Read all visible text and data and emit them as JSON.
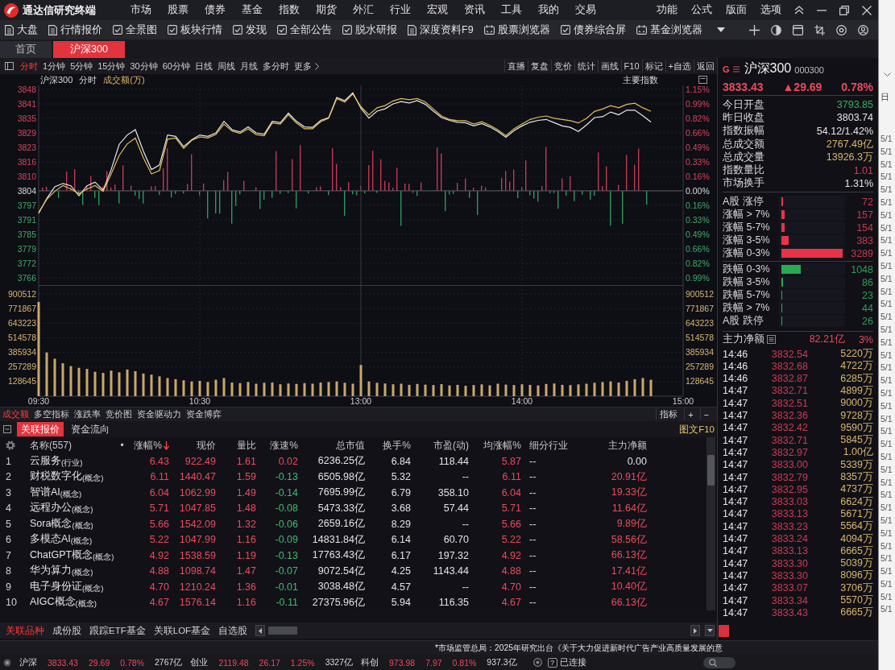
{
  "title_bar": {
    "app_name": "通达信研究终端",
    "menus": [
      "市场",
      "股票",
      "债券",
      "基金",
      "指数",
      "期货",
      "外汇",
      "行业",
      "宏观",
      "资讯",
      "工具",
      "我的",
      "交易"
    ],
    "right_menus": [
      "功能",
      "公式",
      "版面",
      "选项"
    ]
  },
  "toolbar": [
    {
      "label": "大盘",
      "kind": "doc"
    },
    {
      "label": "行情报价",
      "kind": "doc"
    },
    {
      "label": "全景图",
      "kind": "check"
    },
    {
      "label": "板块行情",
      "kind": "check"
    },
    {
      "label": "发现",
      "kind": "check"
    },
    {
      "label": "全部公告",
      "kind": "check"
    },
    {
      "label": "脱水研报",
      "kind": "check"
    },
    {
      "label": "深度资料F9",
      "kind": "doc"
    },
    {
      "label": "股票浏览器",
      "kind": "calendar"
    },
    {
      "label": "债券综合屏",
      "kind": "check"
    },
    {
      "label": "基金浏览器",
      "kind": "calendar"
    }
  ],
  "page_tabs": [
    {
      "label": "首页",
      "selected": false
    },
    {
      "label": "沪深300",
      "selected": true
    }
  ],
  "periods": [
    {
      "label": "分时",
      "kind": "period",
      "selected": true
    },
    {
      "label": "1分钟",
      "kind": "period",
      "selected": false
    },
    {
      "label": "5分钟",
      "kind": "period",
      "selected": false
    },
    {
      "label": "15分钟",
      "kind": "period",
      "selected": false
    },
    {
      "label": "30分钟",
      "kind": "period",
      "selected": false
    },
    {
      "label": "60分钟",
      "kind": "period",
      "selected": false
    },
    {
      "label": "日线",
      "kind": "period",
      "selected": false
    },
    {
      "label": "周线",
      "kind": "period",
      "selected": false
    },
    {
      "label": "月线",
      "kind": "period",
      "selected": false
    },
    {
      "label": "多分时",
      "kind": "period",
      "selected": false
    },
    {
      "label": "更多",
      "kind": "more",
      "selected": false
    }
  ],
  "chart_tools": [
    "直播",
    "复盘",
    "竞价",
    "统计",
    "画线",
    "F10",
    "标记",
    "+自选",
    "返回"
  ],
  "chart_header": {
    "name": "沪深300",
    "period": "分时",
    "indicator": "成交额(万)",
    "index_menu": "主要指数"
  },
  "chart_data": [
    {
      "type": "line",
      "tick_labels": "y",
      "series": [
        {
          "color": "#e8e8e8",
          "values": [
            3794.0,
            3800.4,
            3805.5,
            3806.9,
            3805.9,
            3801.6,
            3805.9,
            3807.5,
            3804.0,
            3812.9,
            3823.8,
            3827.8,
            3830.1,
            3820.8,
            3812.9,
            3814.9,
            3827.8,
            3827.2,
            3822.8,
            3825.8,
            3827.8,
            3827.2,
            3828.7,
            3833.7,
            3830.1,
            3829.1,
            3831.3,
            3828.7,
            3828.2,
            3833.7,
            3833.1,
            3837.3,
            3833.7,
            3831.3,
            3831.1,
            3834.1,
            3835.3,
            3844.0,
            3842.6,
            3846.0,
            3839.3,
            3835.1,
            3838.1,
            3839.1,
            3841.2,
            3842.2,
            3841.6,
            3842.6,
            3841.0,
            3838.1,
            3835.3,
            3834.1,
            3833.3,
            3833.1,
            3831.7,
            3832.7,
            3831.3,
            3829.3,
            3826.8,
            3829.7,
            3831.7,
            3833.3,
            3834.1,
            3834.5,
            3833.1,
            3831.7,
            3831.1,
            3829.3,
            3832.1,
            3835.3,
            3835.7,
            3837.7,
            3836.5,
            3838.5,
            3838.5,
            3836.1,
            3833.4,
            null,
            null,
            null,
            null
          ]
        },
        {
          "color": "#e3bd55",
          "values": [
            3794.5,
            3800.0,
            3803.5,
            3806.0,
            3804.5,
            3802.5,
            3804.5,
            3806.0,
            3803.5,
            3811.0,
            3819.0,
            3824.0,
            3826.5,
            3818.0,
            3811.0,
            3812.5,
            3826.0,
            3826.5,
            3822.0,
            3825.5,
            3827.0,
            3826.5,
            3828.0,
            3832.5,
            3829.5,
            3828.5,
            3830.5,
            3828.0,
            3827.5,
            3833.0,
            3832.5,
            3836.5,
            3833.0,
            3830.5,
            3830.5,
            3833.5,
            3835.0,
            3843.5,
            3842.0,
            3845.5,
            3840.0,
            3836.5,
            3839.5,
            3840.5,
            3842.5,
            3843.5,
            3843.0,
            3843.5,
            3842.0,
            3839.0,
            3836.0,
            3834.5,
            3834.0,
            3834.0,
            3832.5,
            3833.5,
            3832.0,
            3830.0,
            3827.5,
            3830.5,
            3832.5,
            3834.5,
            3835.5,
            3836.0,
            3835.0,
            3834.5,
            3834.0,
            3833.0,
            3835.0,
            3838.0,
            3839.0,
            3840.5,
            3839.5,
            3841.0,
            3841.5,
            3839.5,
            3838.0,
            null,
            null,
            null,
            null
          ]
        }
      ],
      "ylim": [
        3763.1,
        3849.2
      ],
      "yticks": [
        {
          "value": 3847.5,
          "label": "3848"
        },
        {
          "value": 3841.2,
          "label": "3841"
        },
        {
          "value": 3835.0,
          "label": "3835"
        },
        {
          "value": 3828.7,
          "label": "3829"
        },
        {
          "value": 3822.5,
          "label": "3823"
        },
        {
          "value": 3816.2,
          "label": "3816"
        },
        {
          "value": 3810.0,
          "label": "3810"
        },
        {
          "value": 3803.7,
          "label": "3804"
        },
        {
          "value": 3797.5,
          "label": "3797"
        },
        {
          "value": 3791.2,
          "label": "3791"
        },
        {
          "value": 3785.0,
          "label": "3785"
        },
        {
          "value": 3778.7,
          "label": "3779"
        },
        {
          "value": 3772.5,
          "label": "3772"
        },
        {
          "value": 3766.2,
          "label": "3766"
        }
      ],
      "y2lim": [
        -1.068,
        1.195
      ],
      "y2ticks": [
        {
          "value": 1.15,
          "label": "1.15%"
        },
        {
          "value": 0.986,
          "label": "0.99%"
        },
        {
          "value": 0.821,
          "label": "0.82%"
        },
        {
          "value": 0.657,
          "label": "0.66%"
        },
        {
          "value": 0.493,
          "label": "0.49%"
        },
        {
          "value": 0.329,
          "label": "0.33%"
        },
        {
          "value": 0.164,
          "label": "0.16%"
        },
        {
          "value": 0,
          "label": "0.00%"
        },
        {
          "value": -0.164,
          "label": "0.16%"
        },
        {
          "value": -0.329,
          "label": "0.33%"
        },
        {
          "value": -0.493,
          "label": "0.49%"
        },
        {
          "value": -0.657,
          "label": "0.66%"
        },
        {
          "value": -0.821,
          "label": "0.82%"
        },
        {
          "value": -0.986,
          "label": "0.99%"
        }
      ],
      "ref_lines": [
        {
          "axis": "y",
          "value": 3803.74,
          "color": "#5c5c68",
          "line_style": "solid"
        }
      ],
      "grid": true
    },
    {
      "type": "bar",
      "categories": [
        "09:30",
        null,
        null,
        null,
        null,
        null,
        null,
        null,
        null,
        null,
        null,
        null,
        null,
        null,
        null,
        null,
        null,
        null,
        null,
        null,
        "10:30",
        null,
        null,
        null,
        null,
        null,
        null,
        null,
        null,
        null,
        null,
        null,
        null,
        null,
        null,
        null,
        null,
        null,
        null,
        null,
        "13:00",
        null,
        null,
        null,
        null,
        null,
        null,
        null,
        null,
        null,
        null,
        null,
        null,
        null,
        null,
        null,
        null,
        null,
        null,
        null,
        "14:00",
        null,
        null,
        null,
        null,
        null,
        null,
        null,
        null,
        null,
        null,
        null,
        null,
        null,
        null,
        null,
        null,
        null,
        null,
        null,
        "15:00"
      ],
      "values": [
        830000,
        385000,
        330000,
        290000,
        265000,
        250000,
        240000,
        215000,
        205000,
        225000,
        210000,
        235000,
        220000,
        200000,
        190000,
        175000,
        160000,
        150000,
        140000,
        130000,
        135000,
        125000,
        145000,
        160000,
        120000,
        115000,
        125000,
        110000,
        118000,
        120000,
        105000,
        112000,
        108000,
        115000,
        110000,
        120000,
        125000,
        130000,
        118000,
        110000,
        275000,
        130000,
        118000,
        112000,
        105000,
        110000,
        100000,
        108000,
        102000,
        98000,
        106000,
        95000,
        100000,
        92000,
        98000,
        104000,
        96000,
        110000,
        102000,
        98000,
        105000,
        100000,
        95000,
        108000,
        112000,
        100000,
        98000,
        104000,
        110000,
        118000,
        125000,
        130000,
        120000,
        135000,
        150000,
        160000,
        145000,
        null,
        null,
        null,
        null
      ],
      "color": "#c9a86c",
      "ylim": [
        0,
        978400
      ],
      "yticks": [
        128645,
        257289,
        385934,
        514578,
        643223,
        771867,
        900512
      ],
      "y2lim": [
        0,
        978400
      ],
      "y2ticks": [
        128645,
        257289,
        385934,
        514578,
        643223,
        771867,
        900512
      ],
      "grid": true
    }
  ],
  "indicator_tabs": [
    {
      "label": "成交额",
      "selected": true
    },
    {
      "label": "多空指标",
      "selected": false
    },
    {
      "label": "涨跌率",
      "selected": false
    },
    {
      "label": "竞价图",
      "selected": false
    },
    {
      "label": "资金驱动力",
      "selected": false
    },
    {
      "label": "资金博弈",
      "selected": false
    }
  ],
  "indicator_tools": [
    "指标",
    "+",
    "−"
  ],
  "table_tabs": [
    {
      "label": "关联报价",
      "selected": true
    },
    {
      "label": "资金流向",
      "selected": false
    }
  ],
  "table_link": "图文F10",
  "table": {
    "columns": [
      {
        "label": "名称(557)",
        "sorted": false
      },
      {
        "label": "•",
        "sorted": false
      },
      {
        "label": "涨幅%",
        "sorted": true
      },
      {
        "label": "现价",
        "sorted": false
      },
      {
        "label": "量比",
        "sorted": false
      },
      {
        "label": "涨速%",
        "sorted": false
      },
      {
        "label": "总市值",
        "sorted": false
      },
      {
        "label": "换手%",
        "sorted": false
      },
      {
        "label": "市盈(动)",
        "sorted": false
      },
      {
        "label": "均涨幅%",
        "sorted": false
      },
      {
        "label": "细分行业",
        "sorted": false
      },
      {
        "label": "主力净额",
        "sorted": false
      }
    ],
    "rows": [
      {
        "no": "1",
        "name": "云服务$_{(行业)}$",
        "change": "6.43",
        "price": "922.49",
        "vol_ratio": "1.61",
        "speed": "0.02",
        "cap": "6236.25亿",
        "turnover": "6.84",
        "pe": "118.44",
        "avg_change": "5.87",
        "industry": "--",
        "net_flow": "0.00",
        "up": true,
        "speed_up": true,
        "flow_up": false
      },
      {
        "no": "2",
        "name": "财税数字化$_{(概念)}$",
        "change": "6.11",
        "price": "1440.47",
        "vol_ratio": "1.59",
        "speed": "-0.13",
        "cap": "6505.98亿",
        "turnover": "5.32",
        "pe": "--",
        "avg_change": "6.11",
        "industry": "--",
        "net_flow": "20.91亿",
        "up": true,
        "speed_up": false,
        "flow_up": true
      },
      {
        "no": "3",
        "name": "智谱AI$_{(概念)}$",
        "change": "6.04",
        "price": "1062.99",
        "vol_ratio": "1.49",
        "speed": "-0.14",
        "cap": "7695.99亿",
        "turnover": "6.79",
        "pe": "358.10",
        "avg_change": "6.04",
        "industry": "--",
        "net_flow": "19.33亿",
        "up": true,
        "speed_up": false,
        "flow_up": true
      },
      {
        "no": "4",
        "name": "远程办公$_{(概念)}$",
        "change": "5.71",
        "price": "1047.85",
        "vol_ratio": "1.48",
        "speed": "-0.08",
        "cap": "5473.33亿",
        "turnover": "3.68",
        "pe": "57.44",
        "avg_change": "5.71",
        "industry": "--",
        "net_flow": "11.64亿",
        "up": true,
        "speed_up": false,
        "flow_up": true
      },
      {
        "no": "5",
        "name": "Sora概念$_{(概念)}$",
        "change": "5.66",
        "price": "1542.09",
        "vol_ratio": "1.32",
        "speed": "-0.06",
        "cap": "2659.16亿",
        "turnover": "8.29",
        "pe": "--",
        "avg_change": "5.66",
        "industry": "--",
        "net_flow": "9.89亿",
        "up": true,
        "speed_up": false,
        "flow_up": true
      },
      {
        "no": "6",
        "name": "多模态AI$_{(概念)}$",
        "change": "5.22",
        "price": "1047.99",
        "vol_ratio": "1.16",
        "speed": "-0.09",
        "cap": "14831.84亿",
        "turnover": "6.14",
        "pe": "60.70",
        "avg_change": "5.22",
        "industry": "--",
        "net_flow": "58.56亿",
        "up": true,
        "speed_up": false,
        "flow_up": true
      },
      {
        "no": "7",
        "name": "ChatGPT概念$_{(概念)}$",
        "change": "4.92",
        "price": "1538.59",
        "vol_ratio": "1.19",
        "speed": "-0.13",
        "cap": "17763.43亿",
        "turnover": "6.17",
        "pe": "197.32",
        "avg_change": "4.92",
        "industry": "--",
        "net_flow": "66.13亿",
        "up": true,
        "speed_up": false,
        "flow_up": true
      },
      {
        "no": "8",
        "name": "华为算力$_{(概念)}$",
        "change": "4.88",
        "price": "1098.74",
        "vol_ratio": "1.47",
        "speed": "-0.07",
        "cap": "9072.54亿",
        "turnover": "4.25",
        "pe": "1143.44",
        "avg_change": "4.88",
        "industry": "--",
        "net_flow": "17.41亿",
        "up": true,
        "speed_up": false,
        "flow_up": true
      },
      {
        "no": "9",
        "name": "电子身份证$_{(概念)}$",
        "change": "4.70",
        "price": "1210.24",
        "vol_ratio": "1.36",
        "speed": "-0.01",
        "cap": "3038.48亿",
        "turnover": "4.57",
        "pe": "--",
        "avg_change": "4.70",
        "industry": "--",
        "net_flow": "10.40亿",
        "up": true,
        "speed_up": false,
        "flow_up": true
      },
      {
        "no": "10",
        "name": "AIGC概念$_{(概念)}$",
        "change": "4.67",
        "price": "1576.14",
        "vol_ratio": "1.16",
        "speed": "-0.11",
        "cap": "27375.96亿",
        "turnover": "5.94",
        "pe": "116.35",
        "avg_change": "4.67",
        "industry": "--",
        "net_flow": "66.13亿",
        "up": true,
        "speed_up": false,
        "flow_up": true
      }
    ]
  },
  "bottom_tabs": [
    {
      "label": "关联品种",
      "selected": true
    },
    {
      "label": "成份股",
      "selected": false
    },
    {
      "label": "跟踪ETF基金",
      "selected": false
    },
    {
      "label": "关联LOF基金",
      "selected": false
    },
    {
      "label": "自选股",
      "selected": false
    }
  ],
  "news": "*市场监管总局：2025年研究出台《关于大力促进新时代广告产业高质量发展的意",
  "status_bar": {
    "indices": [
      {
        "name": "沪深",
        "price": "3833.43",
        "change": "29.69",
        "pct": "0.78%",
        "amount": "2767亿",
        "up": true
      },
      {
        "name": "创业",
        "price": "2119.48",
        "change": "26.17",
        "pct": "1.25%",
        "amount": "3327亿",
        "up": true
      },
      {
        "name": "科创",
        "price": "973.98",
        "change": "7.97",
        "pct": "0.81%",
        "amount": "937.3亿",
        "up": true
      }
    ],
    "help": "?",
    "connection": "已连接"
  },
  "quote_panel": {
    "badge": "G",
    "name": "沪深300",
    "code": "000300",
    "price": "3833.43",
    "change": "▲29.69",
    "pct": "0.78%",
    "up": true,
    "stats": [
      {
        "label": "今日开盘",
        "value": "3793.85",
        "color": "#35b260"
      },
      {
        "label": "昨日收盘",
        "value": "3803.74",
        "color": "#e4e4e4"
      },
      {
        "label": "指数振幅",
        "value": "54.12/1.42%",
        "color": "#e4e4e4"
      },
      {
        "label": "总成交额",
        "value": "2767.49亿",
        "color": "#d8b56a"
      },
      {
        "label": "总成交量",
        "value": "13926.3万",
        "color": "#d8b56a"
      },
      {
        "label": "指数量比",
        "value": "1.01",
        "color": "#d23c58"
      },
      {
        "label": "市场换手",
        "value": "1.31%",
        "color": "#e4e4e4"
      }
    ],
    "rises": [
      {
        "label": "A股 涨停",
        "value": "72",
        "level": 0.022,
        "color": "#e8334a"
      },
      {
        "label": "涨幅 > 7%",
        "value": "157",
        "level": 0.048,
        "color": "#e8334a"
      },
      {
        "label": "涨幅 5-7%",
        "value": "154",
        "level": 0.047,
        "color": "#e8334a"
      },
      {
        "label": "涨幅 3-5%",
        "value": "383",
        "level": 0.116,
        "color": "#e8334a"
      },
      {
        "label": "涨幅 0-3%",
        "value": "3289",
        "level": 1.0,
        "color": "#e8334a"
      }
    ],
    "falls": [
      {
        "label": "跌幅 0-3%",
        "value": "1048",
        "level": 0.319,
        "color": "#2aa853"
      },
      {
        "label": "跌幅 3-5%",
        "value": "86",
        "level": 0.026,
        "color": "#2aa853"
      },
      {
        "label": "跌幅 5-7%",
        "value": "23",
        "level": 0.007,
        "color": "#2aa853"
      },
      {
        "label": "跌幅 > 7%",
        "value": "44",
        "level": 0.013,
        "color": "#2aa853"
      },
      {
        "label": "A股 跌停",
        "value": "26",
        "level": 0.008,
        "color": "#2aa853"
      }
    ],
    "flow": {
      "label": "主力净额",
      "value": "82.21亿",
      "pct": "3%"
    },
    "trades": [
      {
        "time": "14:46",
        "price": "3832.54",
        "amount": "5220万"
      },
      {
        "time": "14:46",
        "price": "3832.68",
        "amount": "4722万"
      },
      {
        "time": "14:46",
        "price": "3832.87",
        "amount": "6285万"
      },
      {
        "time": "14:47",
        "price": "3832.71",
        "amount": "4899万"
      },
      {
        "time": "14:47",
        "price": "3832.51",
        "amount": "9000万"
      },
      {
        "time": "14:47",
        "price": "3832.36",
        "amount": "9728万"
      },
      {
        "time": "14:47",
        "price": "3832.42",
        "amount": "9590万"
      },
      {
        "time": "14:47",
        "price": "3832.71",
        "amount": "5845万"
      },
      {
        "time": "14:47",
        "price": "3832.97",
        "amount": "1.00亿"
      },
      {
        "time": "14:47",
        "price": "3833.00",
        "amount": "5339万"
      },
      {
        "time": "14:47",
        "price": "3832.79",
        "amount": "8357万"
      },
      {
        "time": "14:47",
        "price": "3832.95",
        "amount": "4737万"
      },
      {
        "time": "14:47",
        "price": "3833.03",
        "amount": "6624万"
      },
      {
        "time": "14:47",
        "price": "3833.13",
        "amount": "5671万"
      },
      {
        "time": "14:47",
        "price": "3833.23",
        "amount": "5564万"
      },
      {
        "time": "14:47",
        "price": "3833.24",
        "amount": "4094万"
      },
      {
        "time": "14:47",
        "price": "3833.13",
        "amount": "6665万"
      },
      {
        "time": "14:47",
        "price": "3833.30",
        "amount": "5039万"
      },
      {
        "time": "14:47",
        "price": "3833.30",
        "amount": "8096万"
      },
      {
        "time": "14:47",
        "price": "3833.07",
        "amount": "3706万"
      },
      {
        "time": "14:47",
        "price": "3833.34",
        "amount": "5570万"
      },
      {
        "time": "14:47",
        "price": "3833.43",
        "amount": "6665万"
      }
    ]
  },
  "background_window": {
    "header": "日",
    "dates": [
      "5/1",
      "5/1",
      "5/1",
      "5/1",
      "5/1",
      "5/1",
      "5/1",
      "5/1",
      "5/1",
      "5/1",
      "5/1",
      "5/1",
      "5/1",
      "5/1",
      "5/1",
      "5/1",
      "5/1",
      "5/1",
      "5/1",
      "5/1",
      "5/1",
      "5/1",
      "5/1",
      "5/1",
      "5/1",
      "5/1",
      "5/1",
      "5/1",
      "5/1",
      "5/1",
      "5/1",
      "5/1",
      "5/1",
      "5/1",
      "5/1",
      "5/1",
      "5/1",
      "5/1"
    ]
  }
}
